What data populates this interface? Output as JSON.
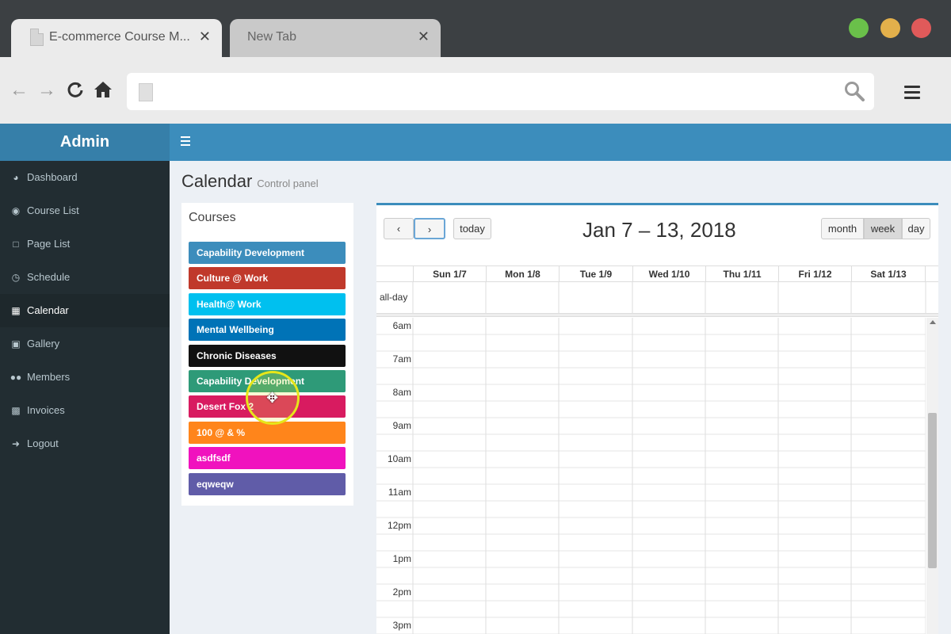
{
  "browser": {
    "tabs": [
      {
        "title": "E-commerce Course M...",
        "close": "✕"
      },
      {
        "title": "New Tab",
        "close": "✕"
      }
    ]
  },
  "sidebar": {
    "brand": "Admin",
    "items": [
      {
        "label": "Dashboard",
        "icon": "dashboard-icon"
      },
      {
        "label": "Course List",
        "icon": "eye-icon"
      },
      {
        "label": "Page List",
        "icon": "file-icon"
      },
      {
        "label": "Schedule",
        "icon": "clock-icon"
      },
      {
        "label": "Calendar",
        "icon": "calendar-icon",
        "active": true
      },
      {
        "label": "Gallery",
        "icon": "image-icon"
      },
      {
        "label": "Members",
        "icon": "users-icon"
      },
      {
        "label": "Invoices",
        "icon": "money-icon"
      },
      {
        "label": "Logout",
        "icon": "sign-out-icon"
      }
    ]
  },
  "page": {
    "title": "Calendar",
    "subtitle": "Control panel"
  },
  "courses": {
    "title": "Courses",
    "items": [
      {
        "label": "Capability Development",
        "color": "#3c8dbc"
      },
      {
        "label": "Culture @ Work",
        "color": "#c0392b"
      },
      {
        "label": "Health@ Work",
        "color": "#00c0ef"
      },
      {
        "label": "Mental Wellbeing",
        "color": "#0073b7"
      },
      {
        "label": "Chronic Diseases",
        "color": "#111111"
      },
      {
        "label": "Capability Development",
        "color": "#2e9a78"
      },
      {
        "label": "Desert Fox 2",
        "color": "#d81b60"
      },
      {
        "label": "100 @ & %",
        "color": "#ff851b"
      },
      {
        "label": "asdfsdf",
        "color": "#f012be"
      },
      {
        "label": "eqweqw",
        "color": "#605ca8"
      }
    ]
  },
  "calendar": {
    "prev": "‹",
    "next": "›",
    "today": "today",
    "title": "Jan 7 – 13, 2018",
    "views": [
      "month",
      "week",
      "day"
    ],
    "active_view": "week",
    "days": [
      "Sun 1/7",
      "Mon 1/8",
      "Tue 1/9",
      "Wed 1/10",
      "Thu 1/11",
      "Fri 1/12",
      "Sat 1/13"
    ],
    "allday_label": "all-day",
    "times": [
      "6am",
      "7am",
      "8am",
      "9am",
      "10am",
      "11am",
      "12pm",
      "1pm",
      "2pm",
      "3pm"
    ]
  }
}
